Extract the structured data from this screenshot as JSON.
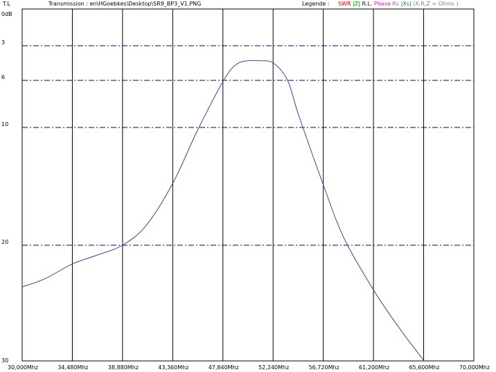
{
  "header": {
    "y_unit_label": "T.L",
    "file_path": "Transmission : en\\HGoebkes\\Desktop\\SR9_BP3_V1.PNG",
    "legend_label": "Legende :",
    "legend_items": [
      {
        "text": "SWR",
        "color": "#ff0000"
      },
      {
        "text": "|Z|",
        "color": "#00a000"
      },
      {
        "text": "R.L.",
        "color": "#0000ff"
      },
      {
        "text": "Phase",
        "color": "#ff00ff"
      },
      {
        "text": "Rs",
        "color": "#808080"
      },
      {
        "text": "|Xs|",
        "color": "#008080"
      },
      {
        "text": "(X,R,Z = Ohms )",
        "color": "#808080"
      }
    ]
  },
  "chart_data": {
    "type": "line",
    "title": "",
    "xlabel": "",
    "ylabel": "T.L",
    "x_ticks": [
      "30,000Mhz",
      "34,480Mhz",
      "38,880Mhz",
      "43,360Mhz",
      "47,840Mhz",
      "52,240Mhz",
      "56,720Mhz",
      "61,200Mhz",
      "65,600Mhz",
      "70,000Mhz"
    ],
    "y_ticks": [
      {
        "value": 0,
        "label": "0dB"
      },
      {
        "value": 3,
        "label": "3"
      },
      {
        "value": 6,
        "label": "6"
      },
      {
        "value": 10,
        "label": "10"
      },
      {
        "value": 20,
        "label": "20"
      },
      {
        "value": 30,
        "label": "30"
      }
    ],
    "xlim": [
      30.0,
      70.0
    ],
    "ylim": [
      0,
      30
    ],
    "y_inverted": true,
    "grid": true,
    "line_color": "#4040a0",
    "series": [
      {
        "x": [
          30.0,
          32.0,
          34.48,
          36.5,
          38.88,
          41.0,
          43.36,
          45.5,
          47.84,
          49.0,
          50.0,
          51.0,
          52.24,
          53.5,
          54.5,
          56.72,
          58.5,
          61.2,
          63.5,
          65.6
        ],
        "y": [
          23.6,
          22.9,
          21.6,
          20.9,
          20.0,
          18.3,
          14.7,
          10.3,
          6.0,
          4.6,
          4.3,
          4.3,
          4.5,
          6.0,
          9.0,
          15.0,
          19.4,
          24.0,
          27.3,
          30.0
        ]
      }
    ]
  }
}
